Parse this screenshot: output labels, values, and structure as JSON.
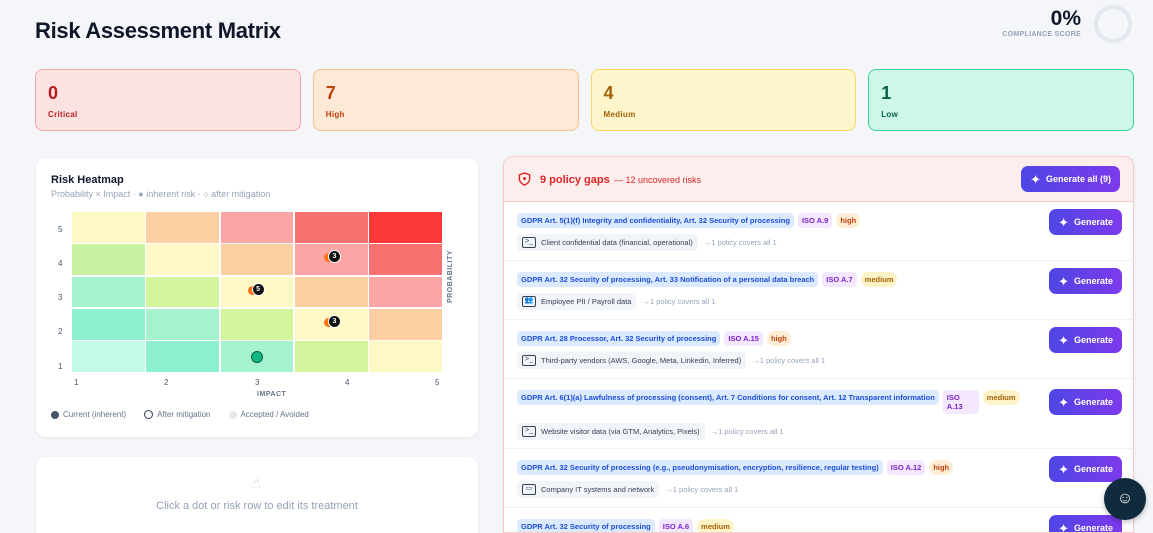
{
  "page": {
    "title": "Risk Assessment Matrix"
  },
  "score": {
    "value": "0%",
    "label": "COMPLIANCE SCORE"
  },
  "cards": [
    {
      "count": "0",
      "label": "Critical"
    },
    {
      "count": "7",
      "label": "High"
    },
    {
      "count": "4",
      "label": "Medium"
    },
    {
      "count": "1",
      "label": "Low"
    }
  ],
  "heatmap": {
    "title": "Risk Heatmap",
    "subtitle": "Probability × Impact · ● inherent risk · ○ after mitigation",
    "x_label": "IMPACT",
    "y_label": "PROBABILITY",
    "x_ticks": [
      "1",
      "2",
      "3",
      "4",
      "5"
    ],
    "y_ticks": [
      "5",
      "4",
      "3",
      "2",
      "1"
    ],
    "cell_colors": [
      [
        "#fef8c4",
        "#fdd0a4",
        "#fca5a5",
        "#f87171",
        "#fd3838"
      ],
      [
        "#c8f3a0",
        "#fef8c4",
        "#fdd0a4",
        "#fca5a5",
        "#f87171"
      ],
      [
        "#a5f2cf",
        "#d2f59c",
        "#fef8c4",
        "#fdd0a4",
        "#fca5a5"
      ],
      [
        "#8df0cc",
        "#a5f2cf",
        "#d2f59c",
        "#fef8c4",
        "#fdd0a4"
      ],
      [
        "#c4f9e5",
        "#8df0cc",
        "#a5f2cf",
        "#d2f59c",
        "#fef8c4"
      ]
    ],
    "markers": [
      {
        "impact": 4,
        "probability": 4,
        "count": "3"
      },
      {
        "impact": 3,
        "probability": 3,
        "count": "5"
      },
      {
        "impact": 4,
        "probability": 2,
        "count": "3"
      }
    ],
    "mitigated": {
      "impact": 3,
      "probability": 1
    },
    "legend": [
      "Current (inherent)",
      "After mitigation",
      "Accepted / Avoided"
    ]
  },
  "hint": {
    "text": "Click a dot or risk row to edit its treatment"
  },
  "gaps": {
    "title": "9 policy gaps",
    "subtitle": "— 12 uncovered risks",
    "generate_all": "Generate all (9)",
    "generate_label": "Generate",
    "rows": [
      {
        "gdpr": "GDPR Art. 5(1)(f) Integrity and confidentiality, Art. 32 Security of processing",
        "iso": "ISO A.9",
        "severity": "high",
        "asset": "Client confidential data (financial, operational)",
        "icon": "terminal-icon",
        "covers": "→1 policy covers all 1"
      },
      {
        "gdpr": "GDPR Art. 32 Security of processing, Art. 33 Notification of a personal data breach",
        "iso": "ISO A.7",
        "severity": "medium",
        "asset": "Employee PII / Payroll data",
        "icon": "users-icon",
        "covers": "→1 policy covers all 1"
      },
      {
        "gdpr": "GDPR Art. 28 Processor, Art. 32 Security of processing",
        "iso": "ISO A.15",
        "severity": "high",
        "asset": "Third-party vendors (AWS, Google, Meta, Linkedin, Inferred)",
        "icon": "terminal-icon",
        "covers": "→1 policy covers all 1"
      },
      {
        "gdpr": "GDPR Art. 6(1)(a) Lawfulness of processing (consent), Art. 7 Conditions for consent, Art. 12 Transparent information",
        "iso": "ISO A.13",
        "severity": "medium",
        "asset": "Website visitor data (via GTM, Analytics, Pixels)",
        "icon": "terminal-icon",
        "covers": "→1 policy covers all 1"
      },
      {
        "gdpr": "GDPR Art. 32 Security of processing (e.g., pseudonymisation, encryption, resilience, regular testing)",
        "iso": "ISO A.12",
        "severity": "high",
        "asset": "Company IT systems and network",
        "icon": "laptop-icon",
        "covers": "→1 policy covers all 1"
      },
      {
        "gdpr": "GDPR Art. 32 Security of processing",
        "iso": "ISO A.6",
        "severity": "medium",
        "asset": "",
        "icon": "terminal-icon",
        "covers": ""
      }
    ]
  }
}
